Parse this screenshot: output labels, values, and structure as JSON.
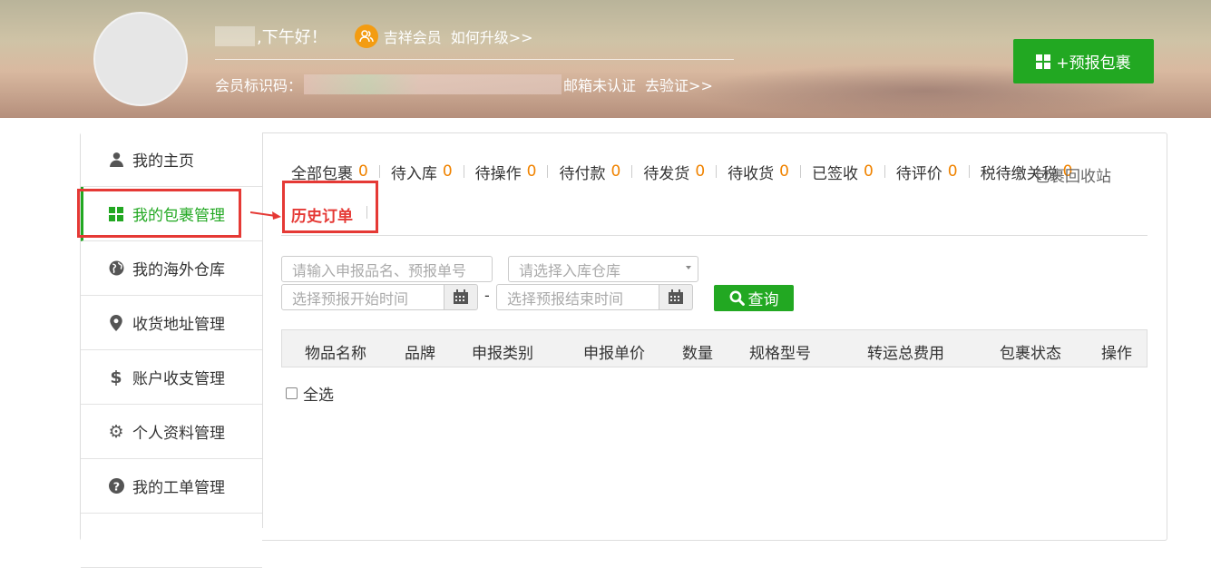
{
  "header": {
    "greeting": ",下午好！",
    "member_level": "吉祥会员",
    "upgrade_link": "如何升级>>",
    "member_id_label": "会员标识码：",
    "email_status": "邮箱未认证",
    "verify_link": "去验证>>",
    "prereport_button": "+预报包裹"
  },
  "sidebar": {
    "items": [
      {
        "label": "我的主页",
        "icon": "user-icon"
      },
      {
        "label": "我的包裹管理",
        "icon": "grid-icon"
      },
      {
        "label": "我的海外仓库",
        "icon": "globe-icon"
      },
      {
        "label": "收货地址管理",
        "icon": "map-marker-icon"
      },
      {
        "label": "账户收支管理",
        "icon": "dollar-icon"
      },
      {
        "label": "个人资料管理",
        "icon": "gear-icon"
      },
      {
        "label": "我的工单管理",
        "icon": "question-icon"
      }
    ]
  },
  "tabs": [
    {
      "label": "全部包裹",
      "count": "0"
    },
    {
      "label": "待入库",
      "count": "0"
    },
    {
      "label": "待操作",
      "count": "0"
    },
    {
      "label": "待付款",
      "count": "0"
    },
    {
      "label": "待发货",
      "count": "0"
    },
    {
      "label": "待收货",
      "count": "0"
    },
    {
      "label": "已签收",
      "count": "0"
    },
    {
      "label": "待评价",
      "count": "0"
    },
    {
      "label": "税待缴关税",
      "count": "0"
    }
  ],
  "recycle_label": "包裹回收站",
  "history_tab": "历史订单",
  "filters": {
    "search_placeholder": "请输入申报品名、预报单号",
    "warehouse_placeholder": "请选择入库仓库",
    "start_placeholder": "选择预报开始时间",
    "dash": "-",
    "end_placeholder": "选择预报结束时间",
    "query_button": "查询"
  },
  "table": {
    "columns": [
      "物品名称",
      "品牌",
      "申报类别",
      "申报单价",
      "数量",
      "规格型号",
      "转运总费用",
      "包裹状态",
      "操作"
    ]
  },
  "select_all": "全选",
  "colors": {
    "accent": "#22a822",
    "count": "#f08300",
    "highlight": "#e53935"
  }
}
